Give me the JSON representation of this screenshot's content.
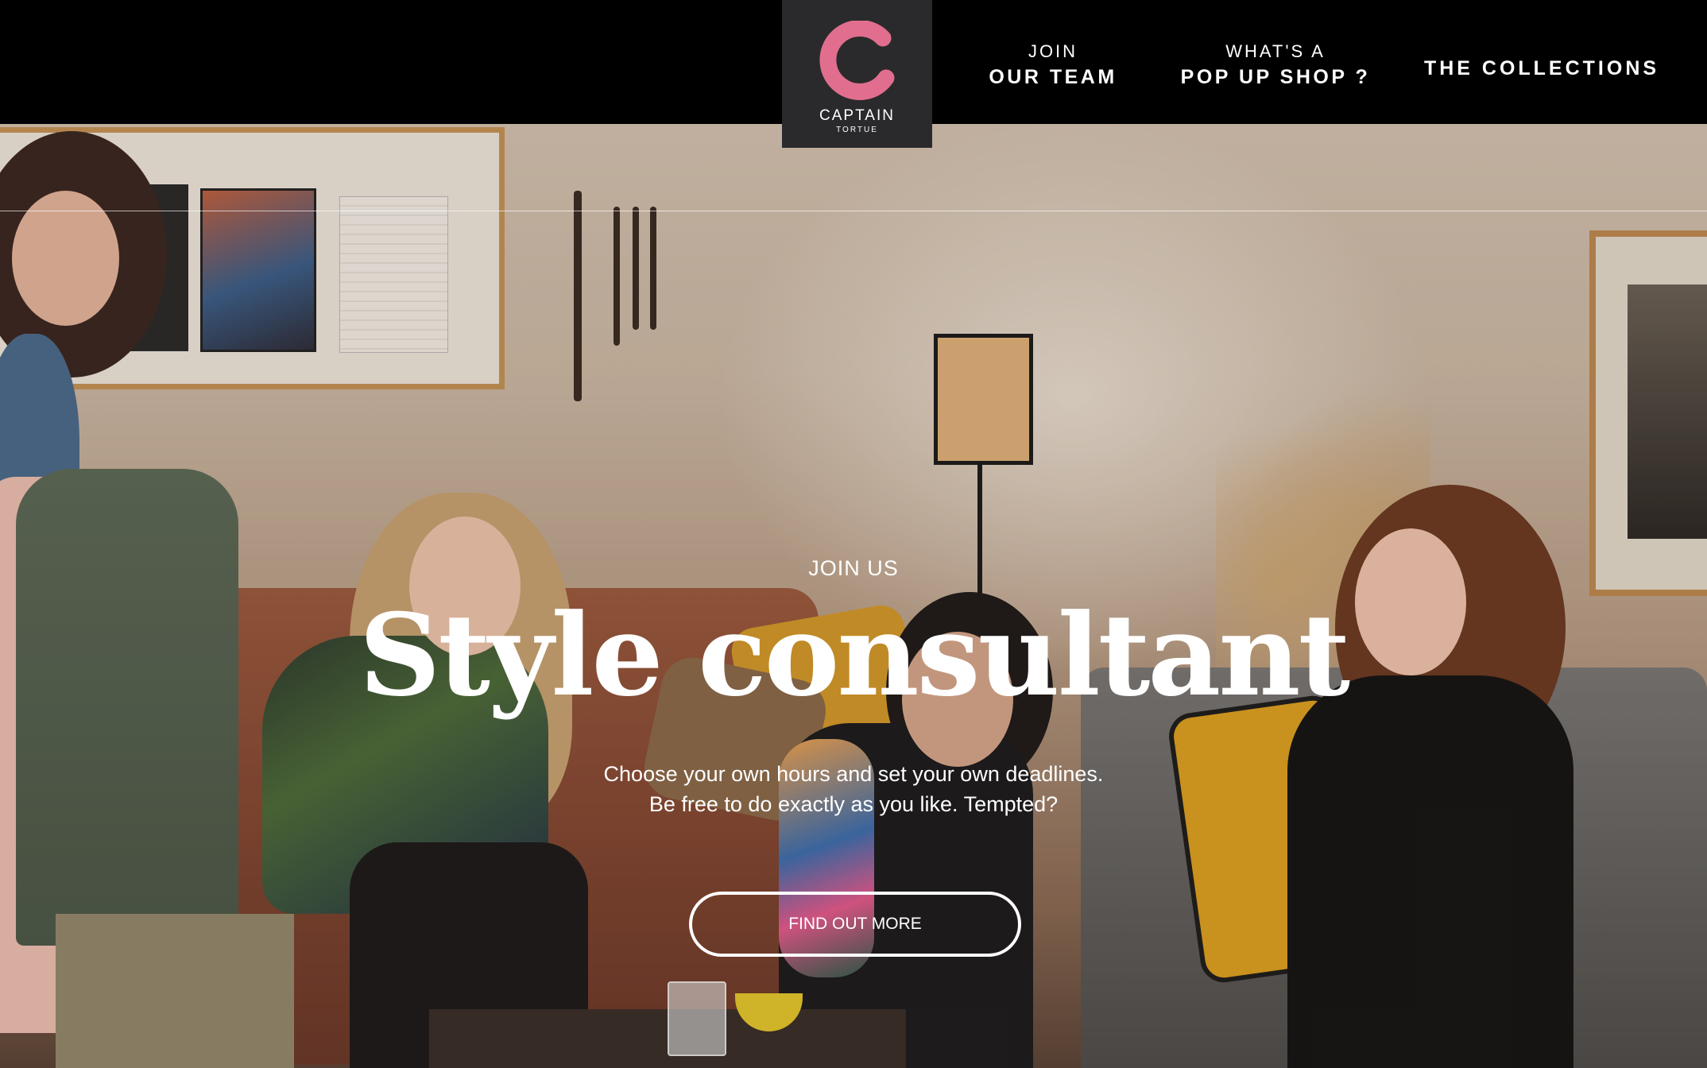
{
  "brand": {
    "name": "CAPTAIN",
    "subname": "TORTUE",
    "logo_icon": "c-ring-logo-icon",
    "logo_color": "#e26e8f"
  },
  "nav": {
    "join_line1": "JOIN",
    "join_line2": "OUR TEAM",
    "popup_line1": "WHAT'S A",
    "popup_line2": "POP UP SHOP ?",
    "collections": "THE COLLECTIONS"
  },
  "hero": {
    "eyebrow": "JOIN US",
    "title": "Style consultant",
    "text_line1": "Choose your own hours and set your own deadlines.",
    "text_line2": "Be free to do exactly as you like. Tempted?",
    "cta_label": "FIND OUT MORE"
  },
  "colors": {
    "header_bg": "#000000",
    "logo_box_bg": "#2a2a2c",
    "text": "#ffffff",
    "accent_pink": "#e26e8f"
  }
}
